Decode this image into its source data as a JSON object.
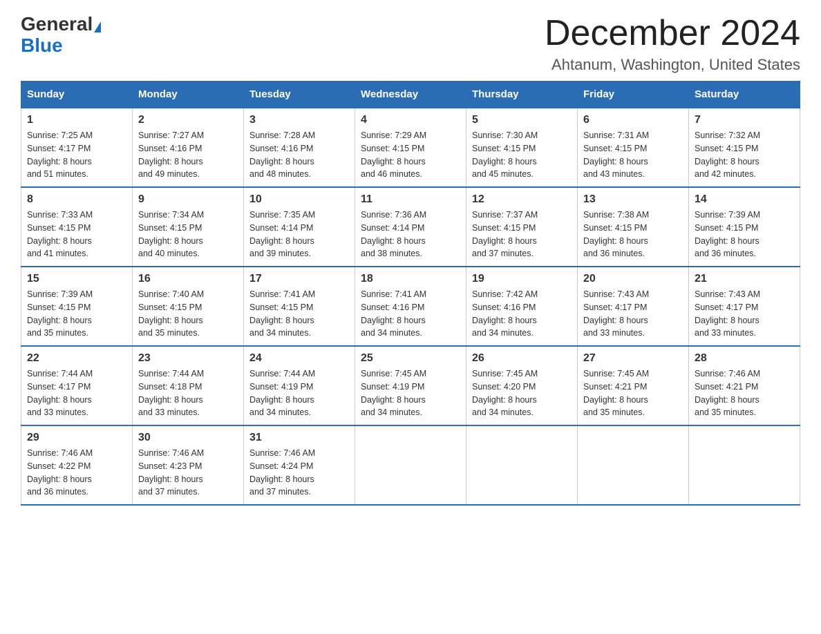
{
  "header": {
    "logo_general": "General",
    "logo_blue": "Blue",
    "title": "December 2024",
    "subtitle": "Ahtanum, Washington, United States"
  },
  "days_of_week": [
    "Sunday",
    "Monday",
    "Tuesday",
    "Wednesday",
    "Thursday",
    "Friday",
    "Saturday"
  ],
  "weeks": [
    [
      {
        "day": "1",
        "sunrise": "7:25 AM",
        "sunset": "4:17 PM",
        "daylight": "8 hours and 51 minutes."
      },
      {
        "day": "2",
        "sunrise": "7:27 AM",
        "sunset": "4:16 PM",
        "daylight": "8 hours and 49 minutes."
      },
      {
        "day": "3",
        "sunrise": "7:28 AM",
        "sunset": "4:16 PM",
        "daylight": "8 hours and 48 minutes."
      },
      {
        "day": "4",
        "sunrise": "7:29 AM",
        "sunset": "4:15 PM",
        "daylight": "8 hours and 46 minutes."
      },
      {
        "day": "5",
        "sunrise": "7:30 AM",
        "sunset": "4:15 PM",
        "daylight": "8 hours and 45 minutes."
      },
      {
        "day": "6",
        "sunrise": "7:31 AM",
        "sunset": "4:15 PM",
        "daylight": "8 hours and 43 minutes."
      },
      {
        "day": "7",
        "sunrise": "7:32 AM",
        "sunset": "4:15 PM",
        "daylight": "8 hours and 42 minutes."
      }
    ],
    [
      {
        "day": "8",
        "sunrise": "7:33 AM",
        "sunset": "4:15 PM",
        "daylight": "8 hours and 41 minutes."
      },
      {
        "day": "9",
        "sunrise": "7:34 AM",
        "sunset": "4:15 PM",
        "daylight": "8 hours and 40 minutes."
      },
      {
        "day": "10",
        "sunrise": "7:35 AM",
        "sunset": "4:14 PM",
        "daylight": "8 hours and 39 minutes."
      },
      {
        "day": "11",
        "sunrise": "7:36 AM",
        "sunset": "4:14 PM",
        "daylight": "8 hours and 38 minutes."
      },
      {
        "day": "12",
        "sunrise": "7:37 AM",
        "sunset": "4:15 PM",
        "daylight": "8 hours and 37 minutes."
      },
      {
        "day": "13",
        "sunrise": "7:38 AM",
        "sunset": "4:15 PM",
        "daylight": "8 hours and 36 minutes."
      },
      {
        "day": "14",
        "sunrise": "7:39 AM",
        "sunset": "4:15 PM",
        "daylight": "8 hours and 36 minutes."
      }
    ],
    [
      {
        "day": "15",
        "sunrise": "7:39 AM",
        "sunset": "4:15 PM",
        "daylight": "8 hours and 35 minutes."
      },
      {
        "day": "16",
        "sunrise": "7:40 AM",
        "sunset": "4:15 PM",
        "daylight": "8 hours and 35 minutes."
      },
      {
        "day": "17",
        "sunrise": "7:41 AM",
        "sunset": "4:15 PM",
        "daylight": "8 hours and 34 minutes."
      },
      {
        "day": "18",
        "sunrise": "7:41 AM",
        "sunset": "4:16 PM",
        "daylight": "8 hours and 34 minutes."
      },
      {
        "day": "19",
        "sunrise": "7:42 AM",
        "sunset": "4:16 PM",
        "daylight": "8 hours and 34 minutes."
      },
      {
        "day": "20",
        "sunrise": "7:43 AM",
        "sunset": "4:17 PM",
        "daylight": "8 hours and 33 minutes."
      },
      {
        "day": "21",
        "sunrise": "7:43 AM",
        "sunset": "4:17 PM",
        "daylight": "8 hours and 33 minutes."
      }
    ],
    [
      {
        "day": "22",
        "sunrise": "7:44 AM",
        "sunset": "4:17 PM",
        "daylight": "8 hours and 33 minutes."
      },
      {
        "day": "23",
        "sunrise": "7:44 AM",
        "sunset": "4:18 PM",
        "daylight": "8 hours and 33 minutes."
      },
      {
        "day": "24",
        "sunrise": "7:44 AM",
        "sunset": "4:19 PM",
        "daylight": "8 hours and 34 minutes."
      },
      {
        "day": "25",
        "sunrise": "7:45 AM",
        "sunset": "4:19 PM",
        "daylight": "8 hours and 34 minutes."
      },
      {
        "day": "26",
        "sunrise": "7:45 AM",
        "sunset": "4:20 PM",
        "daylight": "8 hours and 34 minutes."
      },
      {
        "day": "27",
        "sunrise": "7:45 AM",
        "sunset": "4:21 PM",
        "daylight": "8 hours and 35 minutes."
      },
      {
        "day": "28",
        "sunrise": "7:46 AM",
        "sunset": "4:21 PM",
        "daylight": "8 hours and 35 minutes."
      }
    ],
    [
      {
        "day": "29",
        "sunrise": "7:46 AM",
        "sunset": "4:22 PM",
        "daylight": "8 hours and 36 minutes."
      },
      {
        "day": "30",
        "sunrise": "7:46 AM",
        "sunset": "4:23 PM",
        "daylight": "8 hours and 37 minutes."
      },
      {
        "day": "31",
        "sunrise": "7:46 AM",
        "sunset": "4:24 PM",
        "daylight": "8 hours and 37 minutes."
      },
      null,
      null,
      null,
      null
    ]
  ],
  "labels": {
    "sunrise": "Sunrise:",
    "sunset": "Sunset:",
    "daylight": "Daylight:"
  }
}
